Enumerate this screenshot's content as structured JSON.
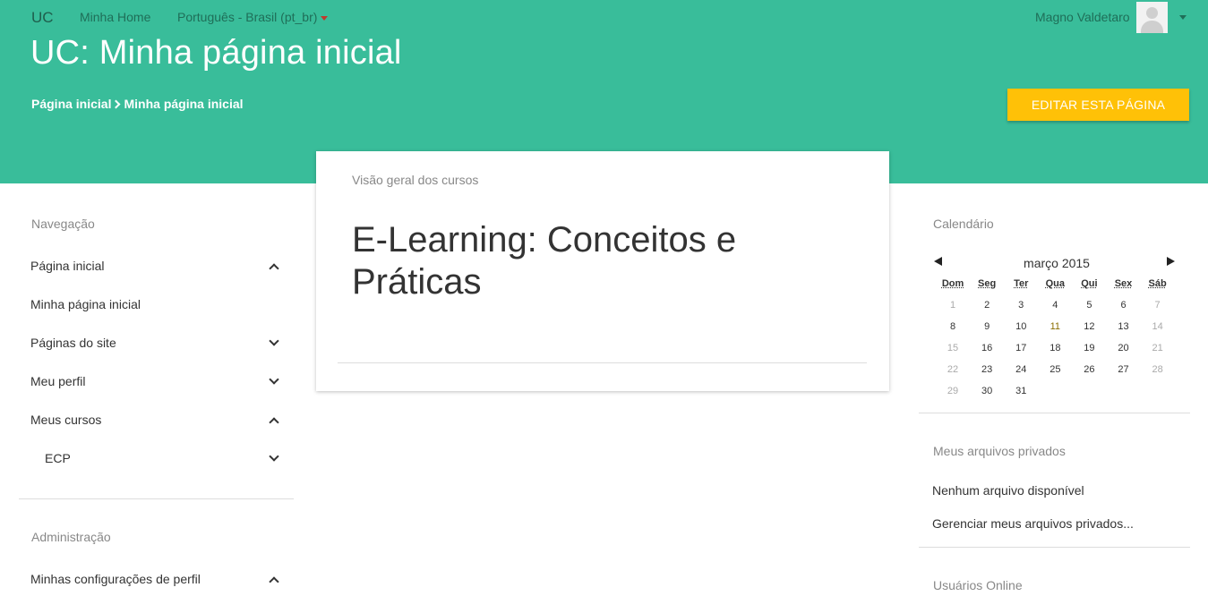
{
  "navbar": {
    "brand": "UC",
    "home": "Minha Home",
    "language": "Português - Brasil (pt_br)",
    "user": "Magno Valdetaro"
  },
  "header": {
    "title": "UC: Minha página inicial",
    "breadcrumb": [
      "Página inicial",
      "Minha página inicial"
    ],
    "edit_button": "EDITAR ESTA PÁGINA"
  },
  "navigation": {
    "title": "Navegação",
    "items": [
      {
        "label": "Página inicial",
        "chevron": "up"
      },
      {
        "label": "Minha página inicial",
        "chevron": ""
      },
      {
        "label": "Páginas do site",
        "chevron": "down"
      },
      {
        "label": "Meu perfil",
        "chevron": "down"
      },
      {
        "label": "Meus cursos",
        "chevron": "up"
      },
      {
        "label": "ECP",
        "chevron": "down"
      }
    ]
  },
  "administration": {
    "title": "Administração",
    "items": [
      {
        "label": "Minhas configurações de perfil",
        "chevron": "up"
      }
    ]
  },
  "overview": {
    "label": "Visão geral dos cursos",
    "course": "E-Learning: Conceitos e Práticas"
  },
  "calendar": {
    "title": "Calendário",
    "month": "março 2015",
    "days": [
      "Dom",
      "Seg",
      "Ter",
      "Qua",
      "Qui",
      "Sex",
      "Sáb"
    ],
    "weeks": [
      [
        "1",
        "2",
        "3",
        "4",
        "5",
        "6",
        "7"
      ],
      [
        "8",
        "9",
        "10",
        "11",
        "12",
        "13",
        "14"
      ],
      [
        "15",
        "16",
        "17",
        "18",
        "19",
        "20",
        "21"
      ],
      [
        "22",
        "23",
        "24",
        "25",
        "26",
        "27",
        "28"
      ],
      [
        "29",
        "30",
        "31",
        "",
        "",
        "",
        ""
      ]
    ]
  },
  "private_files": {
    "title": "Meus arquivos privados",
    "empty": "Nenhum arquivo disponível",
    "manage": "Gerenciar meus arquivos privados..."
  },
  "online_users": {
    "title": "Usuários Online"
  }
}
